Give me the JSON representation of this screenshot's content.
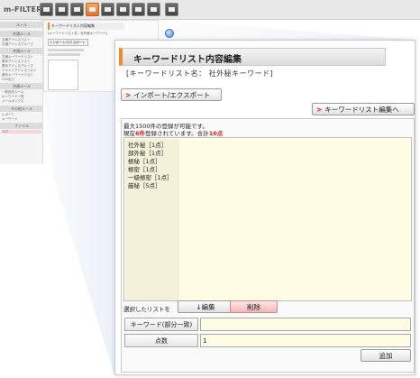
{
  "app": {
    "logo": "m-FILTER",
    "toolbar_icons": [
      "mail-icon",
      "web-icon",
      "grid-icon",
      "document-icon",
      "filter-icon",
      "key-icon",
      "download-icon",
      "print-icon",
      "settings-icon"
    ]
  },
  "sidebar": {
    "heading": "ルール",
    "sections": [
      "共通ルール",
      "共通ルール",
      "共通ルール",
      "その他ルール",
      "ファイル"
    ],
    "items": [
      "共通アドレスリスト",
      "共通アドレスグループ",
      "共通キーワードリスト",
      "基本アドレスリスト",
      "基本アドレスグループ",
      "ドメインアドレスリスト",
      "基本キーワードリスト",
      "CSV出力",
      "一般宛先ルール",
      "キーワード一覧",
      "メールボックス",
      "レポート",
      "キーワード",
      "ログ"
    ]
  },
  "mini_preview": {
    "title": "キーワードリスト内容編集",
    "subtitle": "[キーワードリスト名 : 社外秘キーワード]",
    "button": "インポート/エクスポート"
  },
  "page": {
    "title": "キーワードリスト内容編集",
    "subtitle": "[キーワードリスト名： 社外秘キーワード]",
    "import_button": "インポート/エクスポート",
    "edit_list_button": "キーワードリスト編集へ",
    "info_max": "最大1500件の登録が可能です。",
    "info_current_prefix": "現在",
    "info_current_count": "6件",
    "info_current_middle": "登録されています。合計",
    "info_current_total": "10点",
    "keywords": [
      "社外秘［1点］",
      "部外秘［1点］",
      "極秘［1点］",
      "極密［1点］",
      "一級極密［1点］",
      "厳秘［5点］"
    ],
    "selected_label": "選択したリストを",
    "edit_button": "↓編集",
    "delete_button": "削除",
    "keyword_label": "キーワード(部分一致)",
    "keyword_value": "",
    "points_label": "点数",
    "points_value": "1",
    "add_button": "追加"
  },
  "colors": {
    "accent": "#f08a2a",
    "highlight_red": "#e02020",
    "list_bg": "#fffce6",
    "delete_bg": "#f3b6b6"
  }
}
